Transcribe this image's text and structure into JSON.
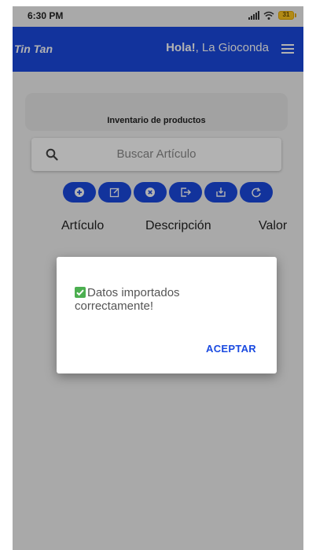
{
  "status_bar": {
    "time": "6:30 PM",
    "battery": "31"
  },
  "app_bar": {
    "brand": "Tin Tan",
    "greeting_bold": "Hola!",
    "greeting_rest": ", La Gioconda"
  },
  "inventory": {
    "title": "Inventario de productos",
    "search_placeholder": "Buscar Artículo",
    "actions": [
      "add-icon",
      "edit-icon",
      "delete-icon",
      "export-icon",
      "import-icon",
      "refresh-icon"
    ],
    "columns": [
      "Artículo",
      "Descripción",
      "Valor"
    ]
  },
  "dialog": {
    "message": "Datos importados correctamente!",
    "button": "ACEPTAR"
  },
  "colors": {
    "primary": "#1a4ae0",
    "check": "#4caf50"
  }
}
